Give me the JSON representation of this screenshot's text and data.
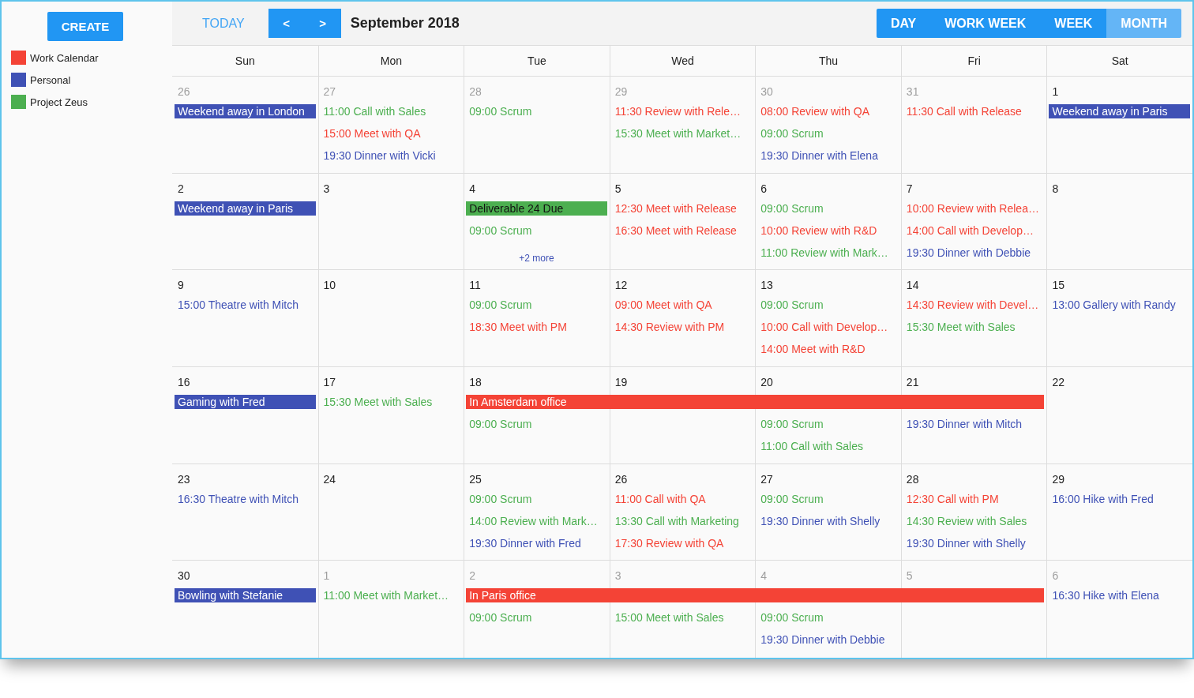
{
  "sidebar": {
    "create_button": "CREATE",
    "calendars": [
      {
        "name": "Work Calendar",
        "color": "#f44336"
      },
      {
        "name": "Personal",
        "color": "#3f51b5"
      },
      {
        "name": "Project Zeus",
        "color": "#4caf50"
      }
    ]
  },
  "toolbar": {
    "today": "TODAY",
    "prev": "<",
    "next": ">",
    "title": "September 2018",
    "views": [
      {
        "label": "DAY",
        "selected": false
      },
      {
        "label": "WORK WEEK",
        "selected": false
      },
      {
        "label": "WEEK",
        "selected": false
      },
      {
        "label": "MONTH",
        "selected": true
      }
    ]
  },
  "weekdays": [
    "Sun",
    "Mon",
    "Tue",
    "Wed",
    "Thu",
    "Fri",
    "Sat"
  ],
  "weeks": [
    {
      "days": [
        {
          "date": "26",
          "other_month": true,
          "events": [
            {
              "kind": "allday",
              "text": "Weekend away in London",
              "color": "#3f51b5"
            }
          ]
        },
        {
          "date": "27",
          "other_month": true,
          "events": [
            {
              "kind": "timed",
              "text": "11:00 Call with Sales",
              "color": "#4caf50"
            },
            {
              "kind": "timed",
              "text": "15:00 Meet with QA",
              "color": "#f44336"
            },
            {
              "kind": "timed",
              "text": "19:30 Dinner with Vicki",
              "color": "#3f51b5"
            }
          ]
        },
        {
          "date": "28",
          "other_month": true,
          "events": [
            {
              "kind": "timed",
              "text": "09:00 Scrum",
              "color": "#4caf50"
            }
          ]
        },
        {
          "date": "29",
          "other_month": true,
          "events": [
            {
              "kind": "timed",
              "text": "11:30 Review with Rele…",
              "color": "#f44336"
            },
            {
              "kind": "timed",
              "text": "15:30 Meet with Market…",
              "color": "#4caf50"
            }
          ]
        },
        {
          "date": "30",
          "other_month": true,
          "events": [
            {
              "kind": "timed",
              "text": "08:00 Review with QA",
              "color": "#f44336"
            },
            {
              "kind": "timed",
              "text": "09:00 Scrum",
              "color": "#4caf50"
            },
            {
              "kind": "timed",
              "text": "19:30 Dinner with Elena",
              "color": "#3f51b5"
            }
          ]
        },
        {
          "date": "31",
          "other_month": true,
          "events": [
            {
              "kind": "timed",
              "text": "11:30 Call with Release",
              "color": "#f44336"
            }
          ]
        },
        {
          "date": "1",
          "other_month": false,
          "events": [
            {
              "kind": "allday",
              "text": "Weekend away in Paris",
              "color": "#3f51b5"
            }
          ]
        }
      ]
    },
    {
      "days": [
        {
          "date": "2",
          "other_month": false,
          "events": [
            {
              "kind": "allday",
              "text": "Weekend away in Paris",
              "color": "#3f51b5"
            }
          ]
        },
        {
          "date": "3",
          "other_month": false
        },
        {
          "date": "4",
          "other_month": false,
          "more": "+2 more",
          "events": [
            {
              "kind": "allday",
              "text": "Deliverable 24 Due",
              "color": "#4caf50"
            },
            {
              "kind": "timed",
              "text": "09:00 Scrum",
              "color": "#4caf50"
            }
          ]
        },
        {
          "date": "5",
          "other_month": false,
          "events": [
            {
              "kind": "timed",
              "text": "12:30 Meet with Release",
              "color": "#f44336"
            },
            {
              "kind": "timed",
              "text": "16:30 Meet with Release",
              "color": "#f44336"
            }
          ]
        },
        {
          "date": "6",
          "other_month": false,
          "events": [
            {
              "kind": "timed",
              "text": "09:00 Scrum",
              "color": "#4caf50"
            },
            {
              "kind": "timed",
              "text": "10:00 Review with R&D",
              "color": "#f44336"
            },
            {
              "kind": "timed",
              "text": "11:00 Review with Mark…",
              "color": "#4caf50"
            }
          ]
        },
        {
          "date": "7",
          "other_month": false,
          "events": [
            {
              "kind": "timed",
              "text": "10:00 Review with Relea…",
              "color": "#f44336"
            },
            {
              "kind": "timed",
              "text": "14:00 Call with Develop…",
              "color": "#f44336"
            },
            {
              "kind": "timed",
              "text": "19:30 Dinner with Debbie",
              "color": "#3f51b5"
            }
          ]
        },
        {
          "date": "8",
          "other_month": false
        }
      ]
    },
    {
      "days": [
        {
          "date": "9",
          "other_month": false,
          "events": [
            {
              "kind": "timed",
              "text": "15:00 Theatre with Mitch",
              "color": "#3f51b5"
            }
          ]
        },
        {
          "date": "10",
          "other_month": false
        },
        {
          "date": "11",
          "other_month": false,
          "events": [
            {
              "kind": "timed",
              "text": "09:00 Scrum",
              "color": "#4caf50"
            },
            {
              "kind": "timed",
              "text": "18:30 Meet with PM",
              "color": "#f44336"
            }
          ]
        },
        {
          "date": "12",
          "other_month": false,
          "events": [
            {
              "kind": "timed",
              "text": "09:00 Meet with QA",
              "color": "#f44336"
            },
            {
              "kind": "timed",
              "text": "14:30 Review with PM",
              "color": "#f44336"
            }
          ]
        },
        {
          "date": "13",
          "other_month": false,
          "events": [
            {
              "kind": "timed",
              "text": "09:00 Scrum",
              "color": "#4caf50"
            },
            {
              "kind": "timed",
              "text": "10:00 Call with Develop…",
              "color": "#f44336"
            },
            {
              "kind": "timed",
              "text": "14:00 Meet with R&D",
              "color": "#f44336"
            }
          ]
        },
        {
          "date": "14",
          "other_month": false,
          "events": [
            {
              "kind": "timed",
              "text": "14:30 Review with Devel…",
              "color": "#f44336"
            },
            {
              "kind": "timed",
              "text": "15:30 Meet with Sales",
              "color": "#4caf50"
            }
          ]
        },
        {
          "date": "15",
          "other_month": false,
          "events": [
            {
              "kind": "timed",
              "text": "13:00 Gallery with Randy",
              "color": "#3f51b5"
            }
          ]
        }
      ]
    },
    {
      "days": [
        {
          "date": "16",
          "other_month": false,
          "events": [
            {
              "kind": "allday",
              "text": "Gaming with Fred",
              "color": "#3f51b5"
            }
          ]
        },
        {
          "date": "17",
          "other_month": false,
          "events": [
            {
              "kind": "timed",
              "text": "15:30 Meet with Sales",
              "color": "#4caf50"
            }
          ]
        },
        {
          "date": "18",
          "other_month": false,
          "banner": {
            "text": "In Amsterdam office",
            "color": "#f44336"
          },
          "events": [
            {
              "kind": "timed",
              "text": "09:00 Scrum",
              "color": "#4caf50"
            }
          ]
        },
        {
          "date": "19",
          "other_month": false,
          "under_banner": true
        },
        {
          "date": "20",
          "other_month": false,
          "under_banner": true,
          "events": [
            {
              "kind": "timed",
              "text": "09:00 Scrum",
              "color": "#4caf50"
            },
            {
              "kind": "timed",
              "text": "11:00 Call with Sales",
              "color": "#4caf50"
            }
          ]
        },
        {
          "date": "21",
          "other_month": false,
          "under_banner": true,
          "events": [
            {
              "kind": "timed",
              "text": "19:30 Dinner with Mitch",
              "color": "#3f51b5"
            }
          ]
        },
        {
          "date": "22",
          "other_month": false
        }
      ]
    },
    {
      "days": [
        {
          "date": "23",
          "other_month": false,
          "events": [
            {
              "kind": "timed",
              "text": "16:30 Theatre with Mitch",
              "color": "#3f51b5"
            }
          ]
        },
        {
          "date": "24",
          "other_month": false
        },
        {
          "date": "25",
          "other_month": false,
          "events": [
            {
              "kind": "timed",
              "text": "09:00 Scrum",
              "color": "#4caf50"
            },
            {
              "kind": "timed",
              "text": "14:00 Review with Mark…",
              "color": "#4caf50"
            },
            {
              "kind": "timed",
              "text": "19:30 Dinner with Fred",
              "color": "#3f51b5"
            }
          ]
        },
        {
          "date": "26",
          "other_month": false,
          "events": [
            {
              "kind": "timed",
              "text": "11:00 Call with QA",
              "color": "#f44336"
            },
            {
              "kind": "timed",
              "text": "13:30 Call with Marketing",
              "color": "#4caf50"
            },
            {
              "kind": "timed",
              "text": "17:30 Review with QA",
              "color": "#f44336"
            }
          ]
        },
        {
          "date": "27",
          "other_month": false,
          "events": [
            {
              "kind": "timed",
              "text": "09:00 Scrum",
              "color": "#4caf50"
            },
            {
              "kind": "timed",
              "text": "19:30 Dinner with Shelly",
              "color": "#3f51b5"
            }
          ]
        },
        {
          "date": "28",
          "other_month": false,
          "events": [
            {
              "kind": "timed",
              "text": "12:30 Call with PM",
              "color": "#f44336"
            },
            {
              "kind": "timed",
              "text": "14:30 Review with Sales",
              "color": "#4caf50"
            },
            {
              "kind": "timed",
              "text": "19:30 Dinner with Shelly",
              "color": "#3f51b5"
            }
          ]
        },
        {
          "date": "29",
          "other_month": false,
          "events": [
            {
              "kind": "timed",
              "text": "16:00 Hike with Fred",
              "color": "#3f51b5"
            }
          ]
        }
      ]
    },
    {
      "days": [
        {
          "date": "30",
          "other_month": false,
          "events": [
            {
              "kind": "allday",
              "text": "Bowling with Stefanie",
              "color": "#3f51b5"
            }
          ]
        },
        {
          "date": "1",
          "other_month": true,
          "events": [
            {
              "kind": "timed",
              "text": "11:00 Meet with Market…",
              "color": "#4caf50"
            }
          ]
        },
        {
          "date": "2",
          "other_month": true,
          "banner": {
            "text": "In Paris office",
            "color": "#f44336"
          },
          "events": [
            {
              "kind": "timed",
              "text": "09:00 Scrum",
              "color": "#4caf50"
            }
          ]
        },
        {
          "date": "3",
          "other_month": true,
          "under_banner": true,
          "events": [
            {
              "kind": "timed",
              "text": "15:00 Meet with Sales",
              "color": "#4caf50"
            }
          ]
        },
        {
          "date": "4",
          "other_month": true,
          "under_banner": true,
          "events": [
            {
              "kind": "timed",
              "text": "09:00 Scrum",
              "color": "#4caf50"
            },
            {
              "kind": "timed",
              "text": "19:30 Dinner with Debbie",
              "color": "#3f51b5"
            }
          ]
        },
        {
          "date": "5",
          "other_month": true,
          "under_banner": true
        },
        {
          "date": "6",
          "other_month": true,
          "events": [
            {
              "kind": "timed",
              "text": "16:30 Hike with Elena",
              "color": "#3f51b5"
            }
          ]
        }
      ]
    }
  ]
}
